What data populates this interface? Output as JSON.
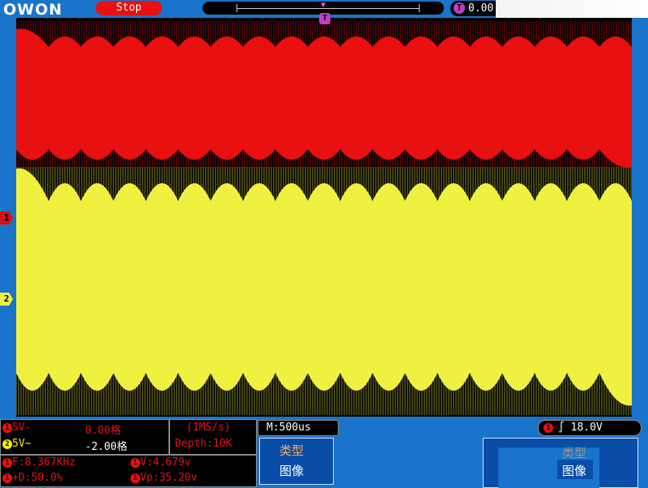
{
  "top": {
    "logo": "OWON",
    "run_state": "Stop",
    "trigger_position": "0.00"
  },
  "channels": {
    "ch1": {
      "marker": "1",
      "scale": "5V-",
      "offset": "0.00格"
    },
    "ch2": {
      "marker": "2",
      "scale": "5V~",
      "offset": "-2.00格"
    }
  },
  "acquisition": {
    "sample_rate": "(1MS/s)",
    "depth": "Depth:10K"
  },
  "timebase": "M:500us",
  "trigger": {
    "icon": "T",
    "level": "18.0V"
  },
  "measurements": {
    "freq": "F:8.367KHz",
    "duty": "+D:50.0%",
    "vavg": "V:4.679v",
    "vpp": "Vp:35.20v"
  },
  "menu": {
    "left_title": "类型",
    "left_value": "图像",
    "right_title": "类型",
    "right_value": "图像"
  },
  "colors": {
    "ch1": "#e81010",
    "ch2": "#f0f040",
    "frame": "#1a74c9"
  }
}
